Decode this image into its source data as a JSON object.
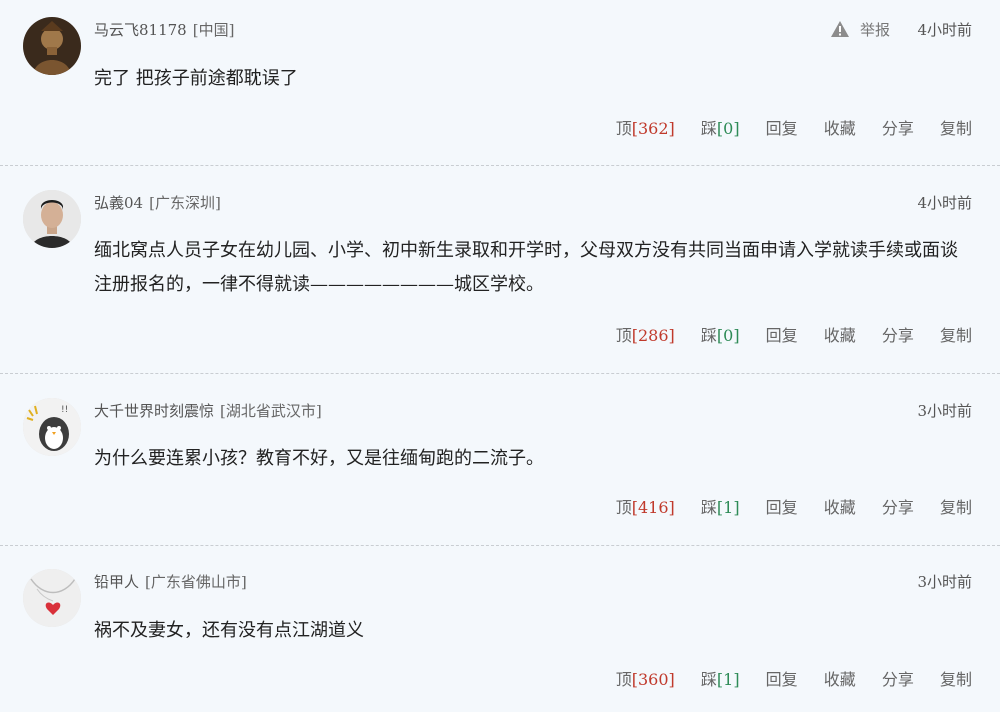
{
  "labels": {
    "report": "举报",
    "up": "顶",
    "down": "踩",
    "reply": "回复",
    "favorite": "收藏",
    "share": "分享",
    "copy": "复制"
  },
  "comments": [
    {
      "user": "马云飞81178",
      "location": "[中国]",
      "time": "4小时前",
      "text": "完了 把孩子前途都耽误了",
      "up": "362",
      "down": "0",
      "avatar_icon": "statue-avatar-icon"
    },
    {
      "user": "弘義04",
      "location": "[广东深圳]",
      "time": "4小时前",
      "text": "缅北窝点人员子女在幼儿园、小学、初中新生录取和开学时，父母双方没有共同当面申请入学就读手续或面谈注册报名的，一律不得就读————————城区学校。",
      "up": "286",
      "down": "0",
      "avatar_icon": "man-portrait-avatar-icon"
    },
    {
      "user": "大千世界时刻震惊",
      "location": "[湖北省武汉市]",
      "time": "3小时前",
      "text": "为什么要连累小孩？教育不好，又是往缅甸跑的二流子。",
      "up": "416",
      "down": "1",
      "avatar_icon": "penguin-avatar-icon"
    },
    {
      "user": "铅甲人",
      "location": "[广东省佛山市]",
      "time": "3小时前",
      "text": "祸不及妻女，还有没有点江湖道义",
      "up": "360",
      "down": "1",
      "avatar_icon": "heart-necklace-avatar-icon"
    }
  ]
}
